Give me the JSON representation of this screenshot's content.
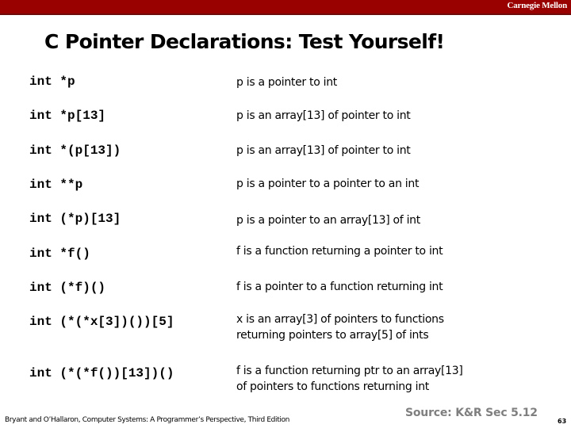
{
  "header": {
    "brand": "Carnegie Mellon",
    "accent_color": "#990000"
  },
  "slide": {
    "title": "C Pointer Declarations: Test Yourself!",
    "rows": [
      {
        "declaration": "int *p",
        "description": [
          "p is a pointer to int"
        ]
      },
      {
        "declaration": "int *p[13]",
        "description": [
          "p is an array[13] of pointer to int"
        ]
      },
      {
        "declaration": "int *(p[13])",
        "description": [
          "p is an array[13] of pointer to int"
        ]
      },
      {
        "declaration": "int **p",
        "description": [
          "p is a pointer to a pointer to an int"
        ]
      },
      {
        "declaration": "int (*p)[13]",
        "description": [
          "p is a pointer to an array[13] of int"
        ]
      },
      {
        "declaration": "int *f()",
        "description": [
          "f is a function returning a pointer to int"
        ]
      },
      {
        "declaration": "int (*f)()",
        "description": [
          "f is a pointer to a function returning int"
        ]
      },
      {
        "declaration": "int (*(*x[3])())[5]",
        "description": [
          "x is an array[3] of pointers  to functions",
          "returning pointers to array[5] of ints"
        ]
      },
      {
        "declaration": "int (*(*f())[13])()",
        "description": [
          "f is a function returning ptr to an array[13]",
          "of pointers to functions returning int"
        ]
      }
    ]
  },
  "footer": {
    "citation": "Bryant and O’Hallaron, Computer Systems: A Programmer’s Perspective, Third Edition",
    "source": "Source: K&R Sec 5.12",
    "page_number": "63"
  }
}
